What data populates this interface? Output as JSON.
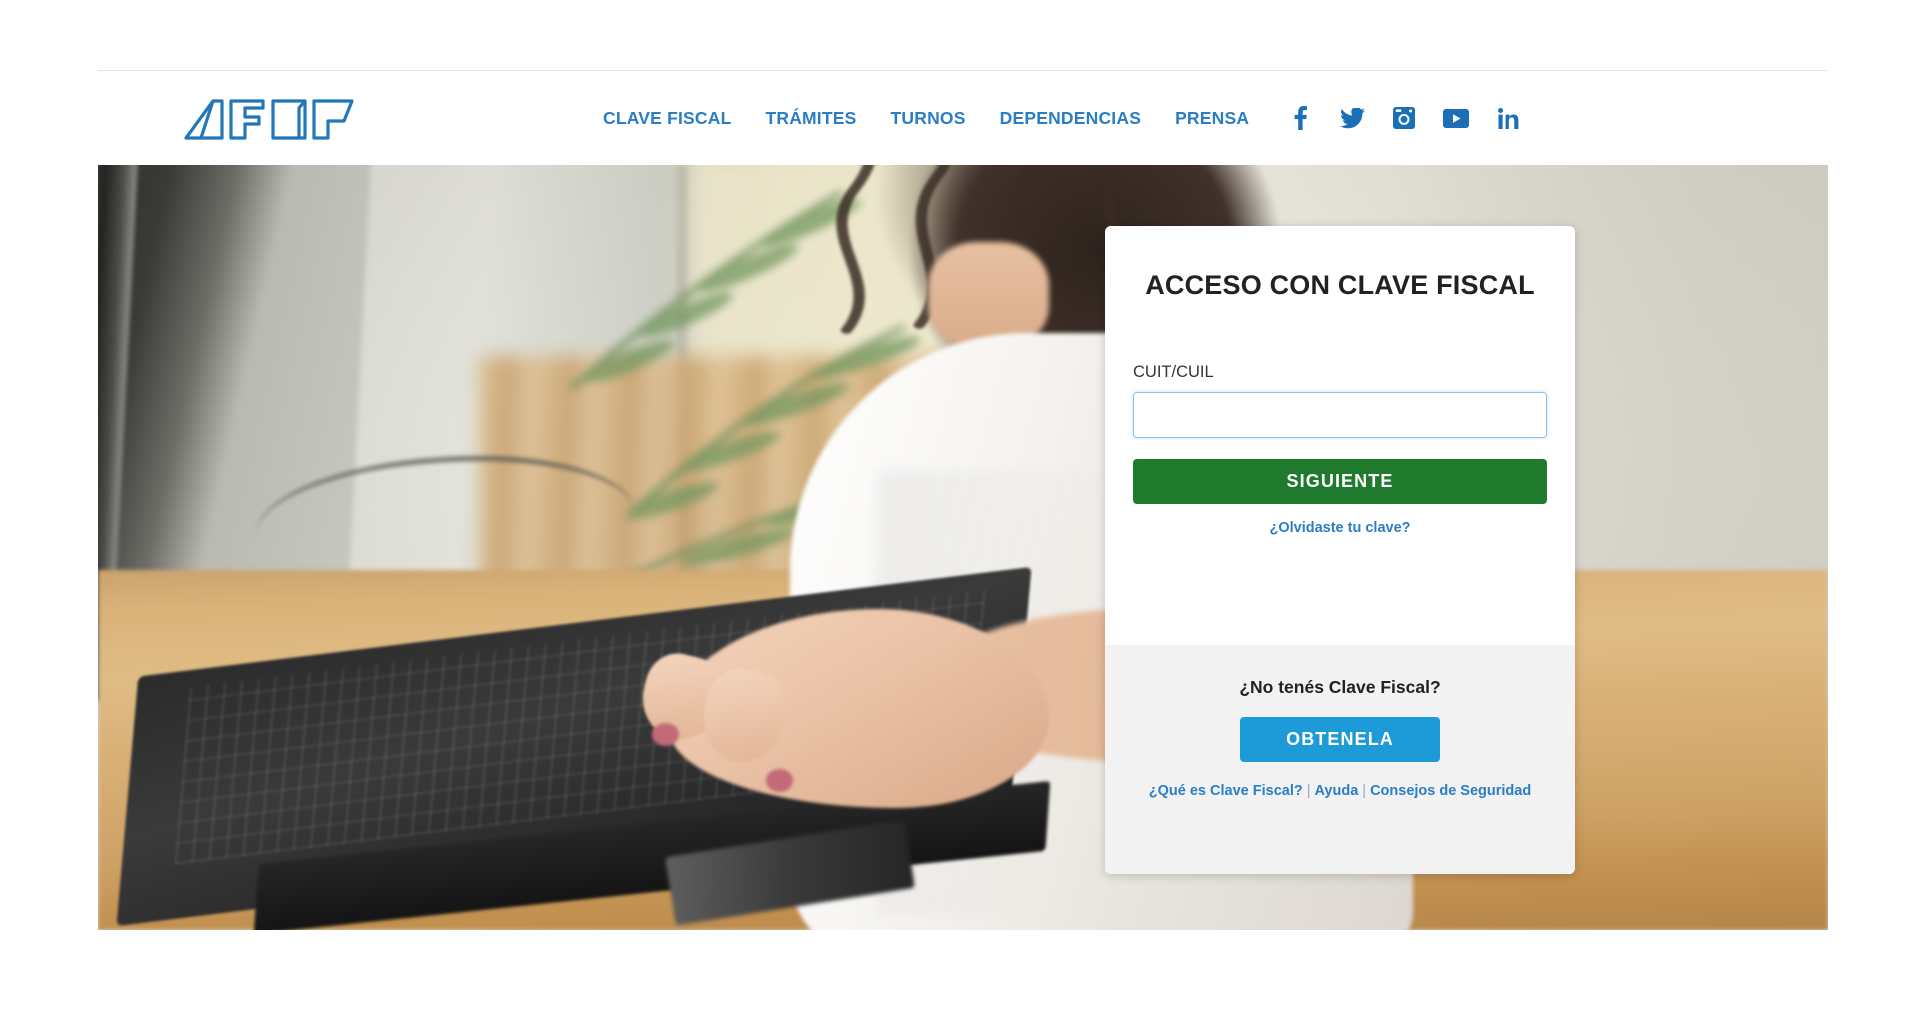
{
  "header": {
    "logo_alt": "AFIP",
    "nav_items": [
      {
        "label": "CLAVE FISCAL",
        "name": "nav-clave-fiscal"
      },
      {
        "label": "TRÁMITES",
        "name": "nav-tramites"
      },
      {
        "label": "TURNOS",
        "name": "nav-turnos"
      },
      {
        "label": "DEPENDENCIAS",
        "name": "nav-dependencias"
      },
      {
        "label": "PRENSA",
        "name": "nav-prensa"
      }
    ],
    "social": [
      {
        "icon": "facebook-icon"
      },
      {
        "icon": "twitter-icon"
      },
      {
        "icon": "instagram-icon"
      },
      {
        "icon": "youtube-icon"
      },
      {
        "icon": "linkedin-icon"
      }
    ]
  },
  "login_card": {
    "title": "ACCESO CON CLAVE FISCAL",
    "cuit_label": "CUIT/CUIL",
    "cuit_value": "",
    "cuit_placeholder": "",
    "next_button": "SIGUIENTE",
    "forgot_link": "¿Olvidaste tu clave?",
    "footer_title": "¿No tenés Clave Fiscal?",
    "obtain_button": "OBTENELA",
    "footer_links": [
      {
        "label": "¿Qué es Clave Fiscal?",
        "name": "link-que-es-clave-fiscal"
      },
      {
        "label": "Ayuda",
        "name": "link-ayuda"
      },
      {
        "label": "Consejos de Seguridad",
        "name": "link-consejos-seguridad"
      }
    ],
    "separator": "|"
  },
  "hero": {
    "alt": "Persona escribiendo en un teclado frente a una computadora en una oficina"
  },
  "colors": {
    "brand_blue": "#2b7dc4",
    "logo_blue": "#1a6fb5",
    "green_button": "#1f7a2e",
    "cyan_button": "#1c9bd8",
    "card_footer_gray": "#f2f2f2",
    "input_border": "#8ec0e8",
    "page_background": "#ffffff"
  }
}
